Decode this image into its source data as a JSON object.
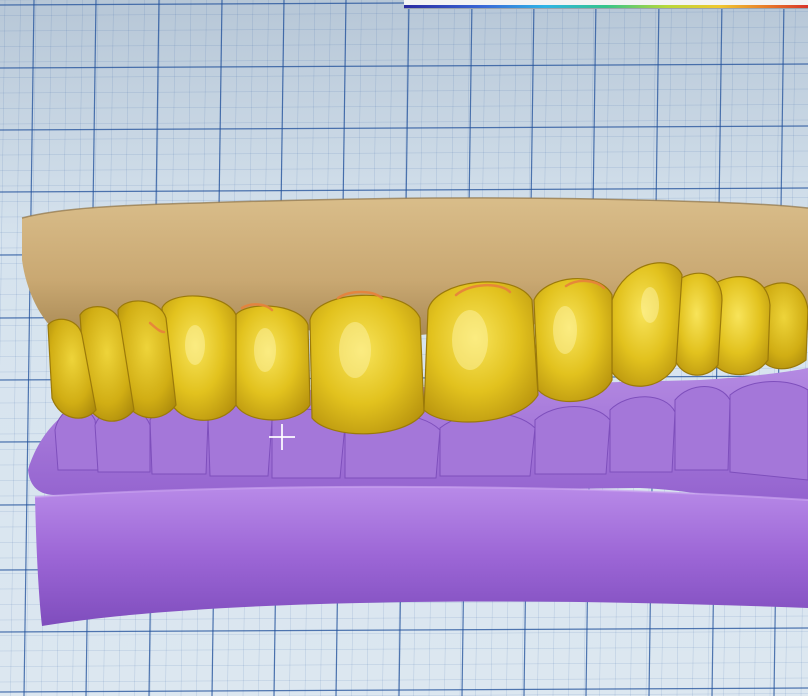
{
  "viewport": {
    "name": "3d-dental-model-view"
  },
  "colors": {
    "background": "#d6e3ee",
    "grid_line": "#1f4f9a",
    "gingiva_upper": "#c9a872",
    "crowns": "#e2c21e",
    "lower_model": "#a77ad8",
    "base_ring": "#9c66d6",
    "margin_line": "#e7823c"
  },
  "legend": {
    "ticks": [
      "",
      "",
      "",
      "",
      "",
      "",
      "",
      "",
      "",
      ""
    ]
  },
  "icons": {
    "cursor": "crosshair-cursor-icon"
  }
}
